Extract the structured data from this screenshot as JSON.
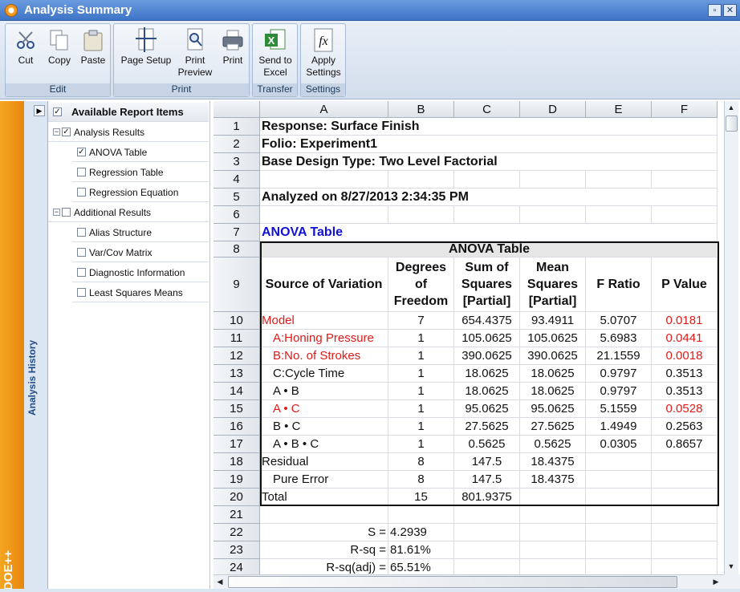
{
  "window": {
    "title": "Analysis Summary",
    "minimize": "▫",
    "close": "✕"
  },
  "ribbon": {
    "groups": [
      {
        "label": "Edit",
        "buttons": [
          "Cut",
          "Copy",
          "Paste"
        ]
      },
      {
        "label": "Print",
        "buttons": [
          "Page Setup",
          "Print Preview",
          "Print"
        ]
      },
      {
        "label": "Transfer",
        "buttons": [
          "Send to Excel"
        ]
      },
      {
        "label": "Settings",
        "buttons": [
          "Apply Settings"
        ]
      }
    ],
    "cut": "Cut",
    "copy": "Copy",
    "paste": "Paste",
    "page_setup": "Page Setup",
    "print_preview_1": "Print",
    "print_preview_2": "Preview",
    "print": "Print",
    "send_excel_1": "Send to",
    "send_excel_2": "Excel",
    "apply_settings_1": "Apply",
    "apply_settings_2": "Settings",
    "edit_label": "Edit",
    "print_label": "Print",
    "transfer_label": "Transfer",
    "settings_label": "Settings"
  },
  "side": {
    "history_label": "Analysis History",
    "logo": "DOE++"
  },
  "tree": {
    "header": "Available Report Items",
    "analysis_results": "Analysis Results",
    "anova_table": "ANOVA Table",
    "regression_table": "Regression Table",
    "regression_equation": "Regression Equation",
    "additional_results": "Additional Results",
    "alias_structure": "Alias Structure",
    "varcov_matrix": "Var/Cov Matrix",
    "diagnostic_information": "Diagnostic Information",
    "least_squares_means": "Least Squares Means"
  },
  "sheet": {
    "columns": [
      "A",
      "B",
      "C",
      "D",
      "E",
      "F"
    ],
    "rows": [
      "1",
      "2",
      "3",
      "4",
      "5",
      "6",
      "7",
      "8",
      "9",
      "10",
      "11",
      "12",
      "13",
      "14",
      "15",
      "16",
      "17",
      "18",
      "19",
      "20",
      "21",
      "22",
      "23",
      "24"
    ],
    "response": "Response: Surface Finish",
    "folio": "Folio: Experiment1",
    "base_design": "Base Design Type: Two Level Factorial",
    "analyzed_on": "Analyzed on 8/27/2013 2:34:35 PM",
    "anova_link": "ANOVA Table",
    "anova_title": "ANOVA Table",
    "headers": {
      "source": "Source of Variation",
      "dof": "Degrees of Freedom",
      "ss": "Sum of Squares [Partial]",
      "ms": "Mean Squares [Partial]",
      "f": "F Ratio",
      "p": "P Value"
    },
    "anova_rows": [
      {
        "src": "Model",
        "dof": "7",
        "ss": "654.4375",
        "ms": "93.4911",
        "f": "5.0707",
        "p": "0.0181"
      },
      {
        "src": "A:Honing Pressure",
        "dof": "1",
        "ss": "105.0625",
        "ms": "105.0625",
        "f": "5.6983",
        "p": "0.0441"
      },
      {
        "src": "B:No. of Strokes",
        "dof": "1",
        "ss": "390.0625",
        "ms": "390.0625",
        "f": "21.1559",
        "p": "0.0018"
      },
      {
        "src": "C:Cycle Time",
        "dof": "1",
        "ss": "18.0625",
        "ms": "18.0625",
        "f": "0.9797",
        "p": "0.3513"
      },
      {
        "src": "A • B",
        "dof": "1",
        "ss": "18.0625",
        "ms": "18.0625",
        "f": "0.9797",
        "p": "0.3513"
      },
      {
        "src": "A • C",
        "dof": "1",
        "ss": "95.0625",
        "ms": "95.0625",
        "f": "5.1559",
        "p": "0.0528"
      },
      {
        "src": "B • C",
        "dof": "1",
        "ss": "27.5625",
        "ms": "27.5625",
        "f": "1.4949",
        "p": "0.2563"
      },
      {
        "src": "A • B • C",
        "dof": "1",
        "ss": "0.5625",
        "ms": "0.5625",
        "f": "0.0305",
        "p": "0.8657"
      },
      {
        "src": "Residual",
        "dof": "8",
        "ss": "147.5",
        "ms": "18.4375",
        "f": "",
        "p": ""
      },
      {
        "src": "Pure Error",
        "dof": "8",
        "ss": "147.5",
        "ms": "18.4375",
        "f": "",
        "p": ""
      },
      {
        "src": "Total",
        "dof": "15",
        "ss": "801.9375",
        "ms": "",
        "f": "",
        "p": ""
      }
    ],
    "s_label": "S =",
    "s_value": "4.2939",
    "rsq_label": "R-sq =",
    "rsq_value": "81.61%",
    "rsqadj_label": "R-sq(adj) =",
    "rsqadj_value": "65.51%"
  },
  "colors": {
    "significant": "#e01a1a",
    "link": "#1010d8"
  }
}
